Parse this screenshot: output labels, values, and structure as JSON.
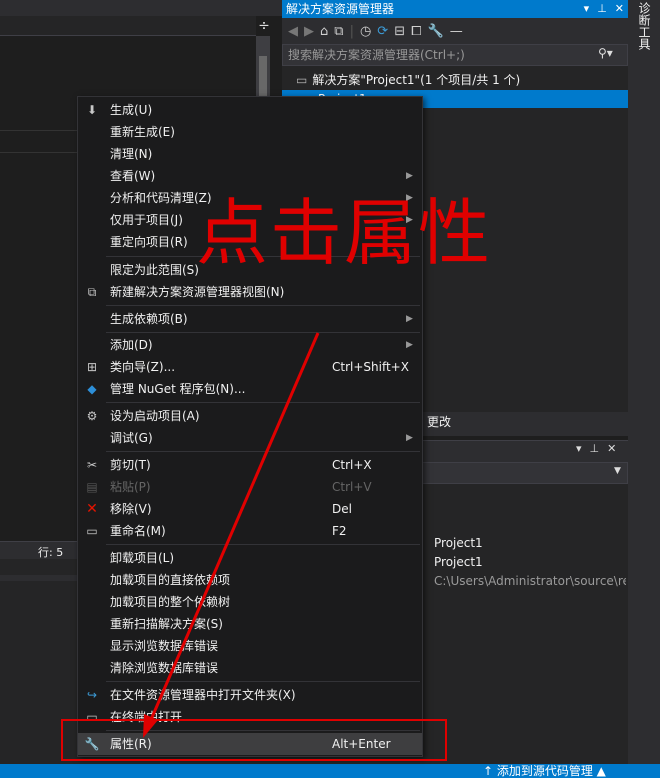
{
  "solution_explorer": {
    "title": "解决方案资源管理器",
    "search_placeholder": "搜索解决方案资源管理器(Ctrl+;)",
    "solution_label": "解决方案\"Project1\"(1 个项目/共 1 个)",
    "project_label": "Project1",
    "changes_tab": "更改"
  },
  "side_panel": {
    "label": "诊断工具"
  },
  "editor": {
    "line_indicator": "行: 5",
    "split_glyph": "÷"
  },
  "properties": {
    "values": [
      "Project1",
      "Project1",
      "C:\\Users\\Administrator\\source\\re"
    ]
  },
  "status_bar": {
    "source_control": "↑ 添加到源代码管理 ▲"
  },
  "context_menu": {
    "items": [
      {
        "label": "生成(U)"
      },
      {
        "label": "重新生成(E)"
      },
      {
        "label": "清理(N)"
      },
      {
        "label": "查看(W)"
      },
      {
        "label": "分析和代码清理(Z)"
      },
      {
        "label": "仅用于项目(J)"
      },
      {
        "label": "重定向项目(R)"
      },
      {
        "label": "限定为此范围(S)"
      },
      {
        "label": "新建解决方案资源管理器视图(N)"
      },
      {
        "label": "生成依赖项(B)"
      },
      {
        "label": "添加(D)"
      },
      {
        "label": "类向导(Z)...",
        "shortcut": "Ctrl+Shift+X"
      },
      {
        "label": "管理 NuGet 程序包(N)..."
      },
      {
        "label": "设为启动项目(A)"
      },
      {
        "label": "调试(G)"
      },
      {
        "label": "剪切(T)",
        "shortcut": "Ctrl+X"
      },
      {
        "label": "粘贴(P)",
        "shortcut": "Ctrl+V"
      },
      {
        "label": "移除(V)",
        "shortcut": "Del"
      },
      {
        "label": "重命名(M)",
        "shortcut": "F2"
      },
      {
        "label": "卸载项目(L)"
      },
      {
        "label": "加载项目的直接依赖项"
      },
      {
        "label": "加载项目的整个依赖树"
      },
      {
        "label": "重新扫描解决方案(S)"
      },
      {
        "label": "显示浏览数据库错误"
      },
      {
        "label": "清除浏览数据库错误"
      },
      {
        "label": "在文件资源管理器中打开文件夹(X)"
      },
      {
        "label": "在终端中打开"
      },
      {
        "label": "属性(R)",
        "shortcut": "Alt+Enter"
      }
    ]
  },
  "annotation": {
    "text": "点击属性",
    "color": "#e00000"
  },
  "colors": {
    "accent": "#007acc",
    "annotation": "#e00000",
    "menu_bg": "#1b1b1c"
  }
}
